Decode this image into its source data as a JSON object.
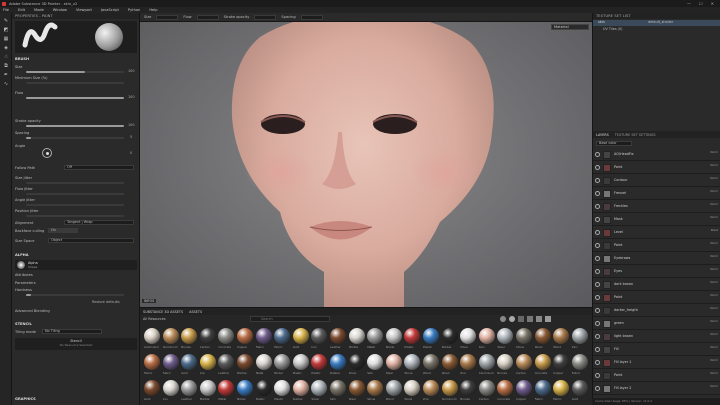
{
  "window": {
    "title": "Adobe Substance 3D Painter - skin_v2"
  },
  "menu": [
    "File",
    "Edit",
    "Mode",
    "Window",
    "Viewport",
    "JavaScript",
    "Python",
    "Help"
  ],
  "toolbar": {
    "size_label": "Size",
    "flow_label": "Flow",
    "stroke_opacity_label": "Stroke opacity",
    "spacing_label": "Spacing"
  },
  "properties": {
    "header": "PROPERTIES - PAINT",
    "brush_title": "BRUSH",
    "size_label": "Size",
    "size_value": "100",
    "min_size_label": "Minimum Size (%)",
    "flow_label": "Flow",
    "flow_value": "100",
    "stroke_opacity_label": "Stroke opacity",
    "stroke_opacity_value": "100",
    "spacing_label": "Spacing",
    "spacing_value": "5",
    "angle_label": "Angle",
    "angle_value": "0",
    "follow_path_label": "Follow Path",
    "follow_path_value": "Off",
    "size_jitter_label": "Size Jitter",
    "flow_jitter_label": "Flow Jitter",
    "angle_jitter_label": "Angle Jitter",
    "position_jitter_label": "Position Jitter",
    "alignment_label": "Alignment",
    "alignment_value": "Tangent | Wrap",
    "backface_label": "Backface culling",
    "backface_value": "On",
    "size_space_label": "Size Space",
    "size_space_value": "Object",
    "alpha_title": "ALPHA",
    "alpha_name": "Alpha",
    "alpha_type": "Shape",
    "attributes_label": "Attributes",
    "parameters_label": "Parameters",
    "hardness_label": "Hardness",
    "restore_label": "Restore defaults",
    "advanced_label": "Advanced Blending",
    "stencil_title": "STENCIL",
    "tiling_label": "Tiling mode",
    "tiling_value": "No Tiling",
    "stencil_name": "Stencil",
    "stencil_empty": "No Resource Selected",
    "graphics_label": "GRAPHICS"
  },
  "viewport": {
    "mode": "Material",
    "footer_label": "INFOS"
  },
  "shelf": {
    "tabs": [
      "SUBSTANCE 3D ASSETS",
      "ASSETS"
    ],
    "filter_label": "All Resources",
    "search_placeholder": "Search",
    "row1": [
      "Aluminium",
      "Aluminium",
      "Bronze",
      "Carbon",
      "Concrete",
      "Copper",
      "Fabric",
      "Fabric",
      "Gold",
      "Iron",
      "Leather",
      "Marble",
      "Metal",
      "Nickel",
      "Plastic",
      "Plastic",
      "Rubber",
      "Silver",
      "Skin",
      "Steel",
      "Stone",
      "Wood",
      "Wood",
      "Zinc"
    ],
    "row2": [
      "Fabric",
      "Fabric",
      "Gold",
      "Iron",
      "Leather",
      "Marble",
      "Metal",
      "Nickel",
      "Plastic",
      "Plastic",
      "Rubber",
      "Silver",
      "Skin",
      "Steel",
      "Stone",
      "Wood",
      "Wood",
      "Zinc",
      "Aluminium",
      "Bronze",
      "Carbon",
      "Concrete",
      "Copper",
      "Fabric"
    ],
    "row3": [
      "Gold",
      "Iron",
      "Leather",
      "Marble",
      "Metal",
      "Nickel",
      "Plastic",
      "Plastic",
      "Rubber",
      "Silver",
      "Skin",
      "Steel",
      "Stone",
      "Wood",
      "Wood",
      "Zinc",
      "Aluminium",
      "Bronze",
      "Carbon",
      "Concrete",
      "Copper",
      "Fabric",
      "Fabric",
      "Gold"
    ]
  },
  "texture_set_list": {
    "header": "TEXTURE SET LIST",
    "item": "skin",
    "item_shader": "default_shader",
    "sub_item": "UV Tiles (0)"
  },
  "layers": {
    "tabs": [
      "LAYERS",
      "TEXTURE SET SETTINGS"
    ],
    "channel": "Base color",
    "items": [
      {
        "name": "AO/HeadFix",
        "blend": "Norm"
      },
      {
        "name": "Paint",
        "blend": "Norm"
      },
      {
        "name": "Contour",
        "blend": "Norm"
      },
      {
        "name": "Fresnel",
        "blend": "Norm"
      },
      {
        "name": "Freckles",
        "blend": "Norm"
      },
      {
        "name": "Mask",
        "blend": "Norm"
      },
      {
        "name": "Level",
        "blend": "Passt"
      },
      {
        "name": "Paint",
        "blend": "Norm"
      },
      {
        "name": "Eyebrows",
        "blend": "Norm"
      },
      {
        "name": "Eyes",
        "blend": "Norm"
      },
      {
        "name": "dark brown",
        "blend": "Norm"
      },
      {
        "name": "Paint",
        "blend": "Norm"
      },
      {
        "name": "darker_freight",
        "blend": "Norm"
      },
      {
        "name": "green",
        "blend": "Norm"
      },
      {
        "name": "light brown",
        "blend": "Norm"
      },
      {
        "name": "Fill",
        "blend": "Norm"
      },
      {
        "name": "Fill layer 1",
        "blend": "Norm"
      },
      {
        "name": "Paint",
        "blend": "Norm"
      },
      {
        "name": "Fill layer 2",
        "blend": "Norm"
      }
    ]
  },
  "status": {
    "text": "Cache Disk Usage: 85% | Version: 11.0.2"
  }
}
